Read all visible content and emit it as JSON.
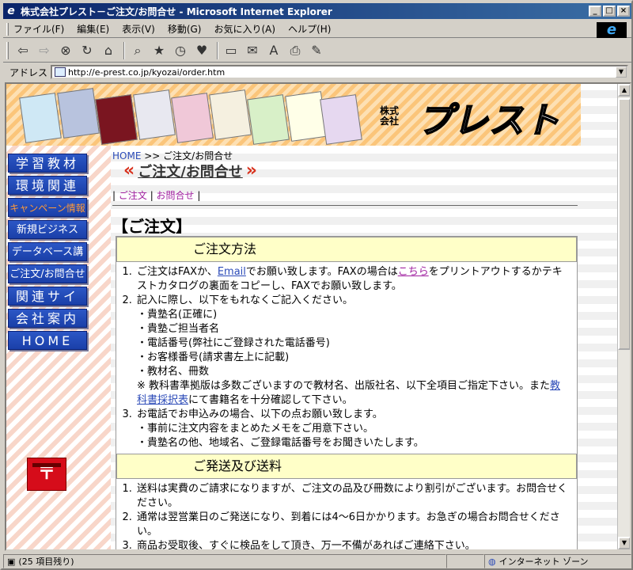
{
  "window": {
    "title": "株式会社プレスト－ご注文/お問合せ - Microsoft Internet Explorer"
  },
  "menubar": {
    "items": [
      "ファイル(F)",
      "編集(E)",
      "表示(V)",
      "移動(G)",
      "お気に入り(A)",
      "ヘルプ(H)"
    ]
  },
  "address": {
    "label": "アドレス",
    "url": "http://e-prest.co.jp/kyozai/order.htm"
  },
  "banner": {
    "corp_label": "株式\n会社",
    "logo_text": "プレスト"
  },
  "nav": {
    "items": [
      "学習教材",
      "環境関連",
      "キャンペーン情報",
      "新規ビジネス",
      "データベース講習",
      "ご注文/お問合せ",
      "関連サイト",
      "会社案内",
      "HOME"
    ]
  },
  "breadcrumb": {
    "home": "HOME",
    "sep": ">>",
    "current": "ご注文/お問合せ"
  },
  "page_title": "ご注文/お問合せ",
  "sublinks": {
    "order": "ご注文",
    "inquiry": "お問合せ"
  },
  "section_heading": "【ご注文】",
  "order_method": {
    "header": "ご注文方法",
    "item1_a": "ご注文はFAXか、",
    "item1_email": "Email",
    "item1_b": "でお願い致します。FAXの場合は",
    "item1_here": "こちら",
    "item1_c": "をプリントアウトするかテキストカタログの裏面をコピーし、FAXでお願い致します。",
    "item2": "記入に際し、以下をもれなくご記入ください。",
    "item2_sub": [
      "・貴塾名(正確に)",
      "・貴塾ご担当者名",
      "・電話番号(弊社にご登録された電話番号)",
      "・お客様番号(請求書左上に記載)",
      "・教材名、冊数"
    ],
    "item2_note_a": "※ 教科書準拠版は多数ございますので教材名、出版社名、以下全項目ご指定下さい。また",
    "item2_note_link": "教科書採択表",
    "item2_note_b": "にて書籍名を十分確認して下さい。",
    "item3": "お電話でお申込みの場合、以下の点お願い致します。",
    "item3_sub": [
      "・事前に注文内容をまとめたメモをご用意下さい。",
      "・貴塾名の他、地域名、ご登録電話番号をお聞きいたします。"
    ]
  },
  "shipping": {
    "header": "ご発送及び送料",
    "items": [
      "送料は実費のご請求になりますが、ご注文の品及び冊数により割引がございます。お問合せください。",
      "通常は翌営業日のご発送になり、到着には4～6日かかります。お急ぎの場合お問合せください。",
      "商品お受取後、すぐに検品をして頂き、万一不備があればご連絡下さい。"
    ]
  },
  "status": {
    "left": "(25 項目残り)",
    "zone": "インターネット ゾーン"
  }
}
